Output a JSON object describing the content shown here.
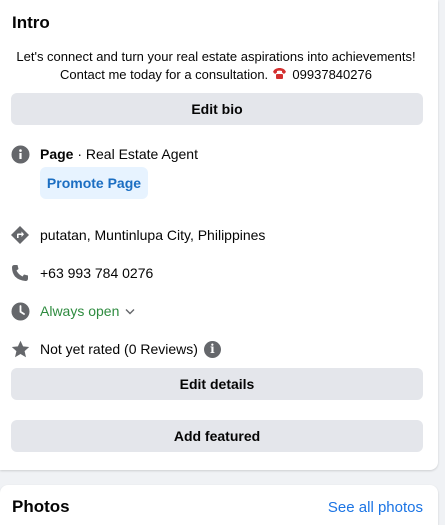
{
  "intro": {
    "title": "Intro",
    "bio_line1": "Let's connect and turn your real estate aspirations into achievements!",
    "bio_line2": "Contact me today for a consultation.",
    "bio_phone": "09937840276",
    "edit_bio_label": "Edit bio",
    "page_label": "Page",
    "page_category": " · Real Estate Agent",
    "promote_label": "Promote Page",
    "address": "putatan, Muntinlupa City, Philippines",
    "phone": "+63 993 784 0276",
    "hours": "Always open",
    "rating": "Not yet rated (0 Reviews)",
    "edit_details_label": "Edit details",
    "add_featured_label": "Add featured"
  },
  "photos": {
    "title": "Photos",
    "see_all_label": "See all photos"
  },
  "colors": {
    "icon_gray": "#65676b",
    "link_blue": "#1b74e4",
    "open_green": "#2e8b3f",
    "button_gray": "#e4e6eb",
    "promote_bg": "#e7f3ff"
  }
}
